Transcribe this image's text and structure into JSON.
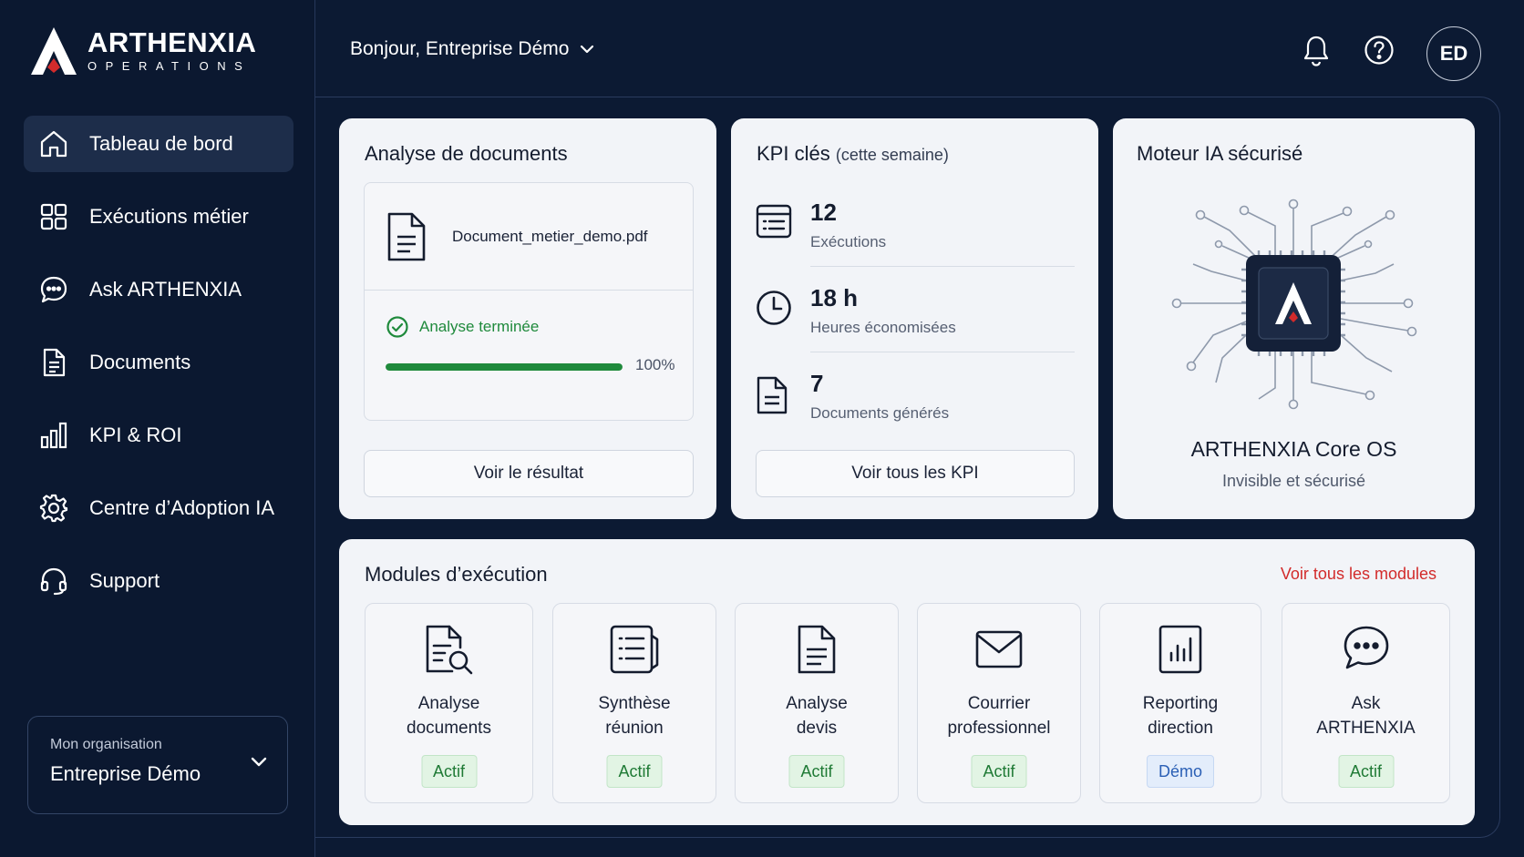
{
  "brand": {
    "name": "ARTHENXIA",
    "subtitle": "OPERATIONS",
    "accent": "#d22b2b"
  },
  "sidebar": {
    "items": [
      {
        "label": "Tableau de bord",
        "icon": "home-icon",
        "active": true
      },
      {
        "label": "Exécutions métier",
        "icon": "grid-icon",
        "active": false
      },
      {
        "label": "Ask ARTHENXIA",
        "icon": "chat-icon",
        "active": false
      },
      {
        "label": "Documents",
        "icon": "document-icon",
        "active": false
      },
      {
        "label": "KPI & ROI",
        "icon": "bar-chart-icon",
        "active": false
      },
      {
        "label": "Centre d’Adoption IA",
        "icon": "gear-icon",
        "active": false
      },
      {
        "label": "Support",
        "icon": "headset-icon",
        "active": false
      }
    ],
    "org": {
      "label": "Mon organisation",
      "value": "Entreprise Démo"
    }
  },
  "header": {
    "greeting": "Bonjour, Entreprise Démo",
    "avatar_initials": "ED"
  },
  "doc_card": {
    "title": "Analyse de documents",
    "file_name": "Document_metier_demo.pdf",
    "status": "Analyse terminée",
    "progress": 1.0,
    "progress_label": "100%",
    "button": "Voir le résultat"
  },
  "kpi_card": {
    "title": "KPI clés",
    "period": "(cette semaine)",
    "items": [
      {
        "value": "12",
        "label": "Exécutions",
        "icon": "list-icon"
      },
      {
        "value": "18 h",
        "label": "Heures économisées",
        "icon": "clock-icon"
      },
      {
        "value": "7",
        "label": "Documents générés",
        "icon": "document-icon"
      }
    ],
    "button": "Voir tous les KPI"
  },
  "ai_card": {
    "title": "Moteur IA sécurisé",
    "name": "ARTHENXIA Core OS",
    "subtitle": "Invisible et sécurisé"
  },
  "modules": {
    "title": "Modules d’exécution",
    "link": "Voir tous les modules",
    "items": [
      {
        "label": "Analyse\ndocuments",
        "status": "Actif",
        "icon": "document-search-icon"
      },
      {
        "label": "Synthèse\nréunion",
        "status": "Actif",
        "icon": "meeting-notes-icon"
      },
      {
        "label": "Analyse\ndevis",
        "status": "Actif",
        "icon": "quote-document-icon"
      },
      {
        "label": "Courrier\nprofessionnel",
        "status": "Actif",
        "icon": "mail-icon"
      },
      {
        "label": "Reporting\ndirection",
        "status": "Démo",
        "icon": "report-chart-icon"
      },
      {
        "label": "Ask\nARTHENXIA",
        "status": "Actif",
        "icon": "chat-icon"
      }
    ]
  }
}
